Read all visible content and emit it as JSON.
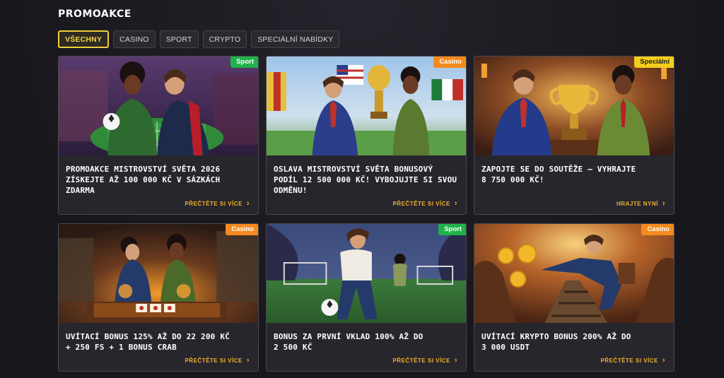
{
  "page": {
    "title": "PROMOAKCE"
  },
  "tabs": [
    {
      "label": "VŠECHNY",
      "active": true
    },
    {
      "label": "CASINO",
      "active": false
    },
    {
      "label": "SPORT",
      "active": false
    },
    {
      "label": "CRYPTO",
      "active": false
    },
    {
      "label": "SPECIÁLNÍ NABÍDKY",
      "active": false
    }
  ],
  "cards": [
    {
      "badge": "Sport",
      "badge_type": "sport",
      "image": "football-table-illustration",
      "title": "PROMOAKCE MISTROVSTVÍ SVĚTA 2026\nZÍSKEJTE AŽ 100 000 KČ V SÁZKÁCH\nZDARMA",
      "link": "PŘEČTĚTE SI VÍCE"
    },
    {
      "badge": "Casino",
      "badge_type": "casino",
      "image": "world-cup-celebration-illustration",
      "title": "OSLAVA MISTROVSTVÍ SVĚTA BONUSOVÝ\nPODÍL 12 500 000 KČ! VYBOJUJTE SI SVOU\nODMĚNU!",
      "link": "PŘEČTĚTE SI VÍCE"
    },
    {
      "badge": "Speciální",
      "badge_type": "special",
      "image": "trophy-contest-illustration",
      "title": "ZAPOJTE SE DO SOUTĚŽE – VYHRAJTE\n8 750 000 KČ!",
      "link": "HRAJTE NYNÍ"
    },
    {
      "badge": "Casino",
      "badge_type": "casino",
      "image": "slot-machine-illustration",
      "title": "UVÍTACÍ BONUS 125% AŽ DO 22 200 KČ\n+ 250 FS + 1 BONUS CRAB",
      "link": "PŘEČTĚTE SI VÍCE"
    },
    {
      "badge": "Sport",
      "badge_type": "sport",
      "image": "football-player-illustration",
      "title": "BONUS ZA PRVNÍ VKLAD 100% AŽ DO\n2 500 KČ",
      "link": "PŘEČTĚTE SI VÍCE"
    },
    {
      "badge": "Casino",
      "badge_type": "casino",
      "image": "crypto-coins-illustration",
      "title": "UVÍTACÍ KRYPTO BONUS 200% AŽ DO\n3 000 USDT",
      "link": "PŘEČTĚTE SI VÍCE"
    }
  ],
  "colors": {
    "accent": "#f2cf3a",
    "link": "#f0b02a",
    "sport_badge": "#1fb24a",
    "casino_badge": "#f58a1f",
    "special_badge": "#f2cf1c",
    "background": "#1b1a20"
  }
}
